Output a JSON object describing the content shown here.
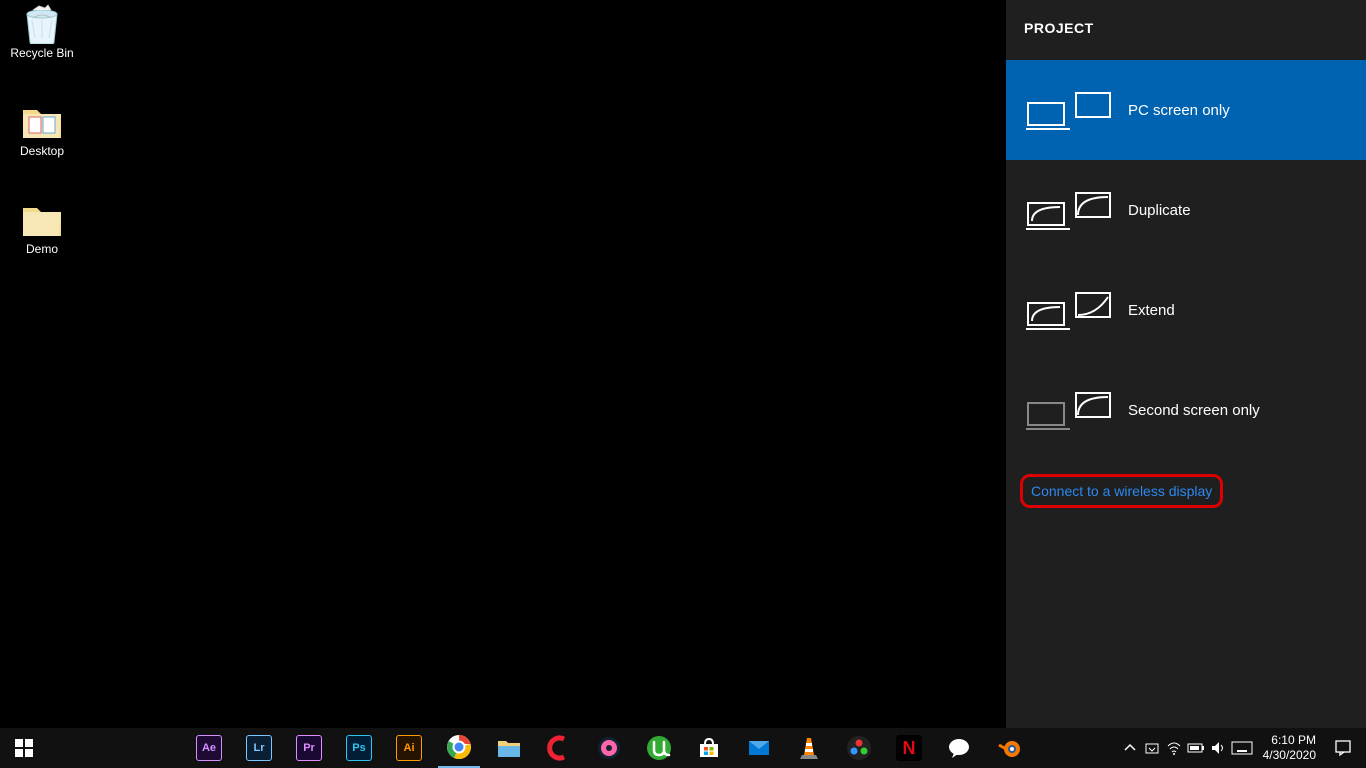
{
  "desktop": {
    "icons": [
      {
        "label": "Recycle Bin"
      },
      {
        "label": "Desktop"
      },
      {
        "label": "Demo"
      }
    ]
  },
  "project_panel": {
    "title": "PROJECT",
    "options": [
      {
        "label": "PC screen only",
        "selected": true
      },
      {
        "label": "Duplicate",
        "selected": false
      },
      {
        "label": "Extend",
        "selected": false
      },
      {
        "label": "Second screen only",
        "selected": false
      }
    ],
    "wireless_link": "Connect to a wireless display"
  },
  "taskbar": {
    "apps": [
      {
        "name": "after-effects",
        "short": "Ae",
        "bg": "#1f0a33",
        "fg": "#d291ff",
        "border": "#d291ff"
      },
      {
        "name": "lightroom",
        "short": "Lr",
        "bg": "#0a1f33",
        "fg": "#7cc7ff",
        "border": "#7cc7ff"
      },
      {
        "name": "premiere",
        "short": "Pr",
        "bg": "#1a0a33",
        "fg": "#e28cff",
        "border": "#e28cff"
      },
      {
        "name": "photoshop",
        "short": "Ps",
        "bg": "#001e36",
        "fg": "#31c5f0",
        "border": "#31c5f0"
      },
      {
        "name": "illustrator",
        "short": "Ai",
        "bg": "#261300",
        "fg": "#ff9a00",
        "border": "#ff9a00"
      }
    ],
    "clock": {
      "time": "6:10 PM",
      "date": "4/30/2020"
    }
  }
}
